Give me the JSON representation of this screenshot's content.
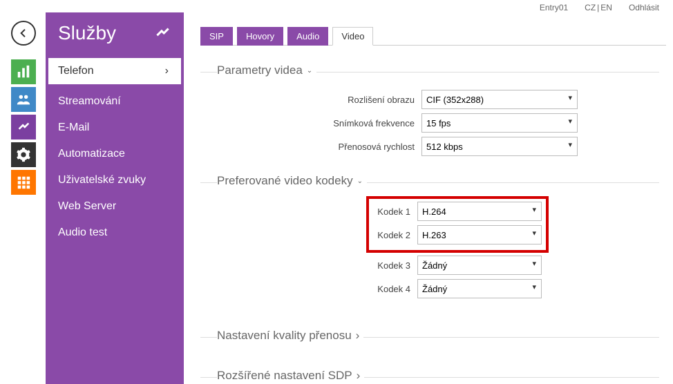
{
  "topbar": {
    "entry": "Entry01",
    "lang_cz": "CZ",
    "lang_en": "EN",
    "logout": "Odhlásit"
  },
  "sidebar": {
    "title": "Služby",
    "items": [
      "Telefon",
      "Streamování",
      "E-Mail",
      "Automatizace",
      "Uživatelské zvuky",
      "Web Server",
      "Audio test"
    ],
    "active_index": 0
  },
  "tabs": {
    "items": [
      "SIP",
      "Hovory",
      "Audio",
      "Video"
    ],
    "active_index": 3
  },
  "sections": {
    "params": {
      "title": "Parametry videa",
      "resolution": {
        "label": "Rozlišení obrazu",
        "value": "CIF (352x288)"
      },
      "framerate": {
        "label": "Snímková frekvence",
        "value": "15 fps"
      },
      "bitrate": {
        "label": "Přenosová rychlost",
        "value": "512 kbps"
      }
    },
    "codecs": {
      "title": "Preferované video kodeky",
      "codec1": {
        "label": "Kodek 1",
        "value": "H.264"
      },
      "codec2": {
        "label": "Kodek 2",
        "value": "H.263"
      },
      "codec3": {
        "label": "Kodek 3",
        "value": "Žádný"
      },
      "codec4": {
        "label": "Kodek 4",
        "value": "Žádný"
      }
    },
    "quality": {
      "title": "Nastavení kvality přenosu"
    },
    "sdp": {
      "title": "Rozšířené nastavení SDP"
    }
  }
}
